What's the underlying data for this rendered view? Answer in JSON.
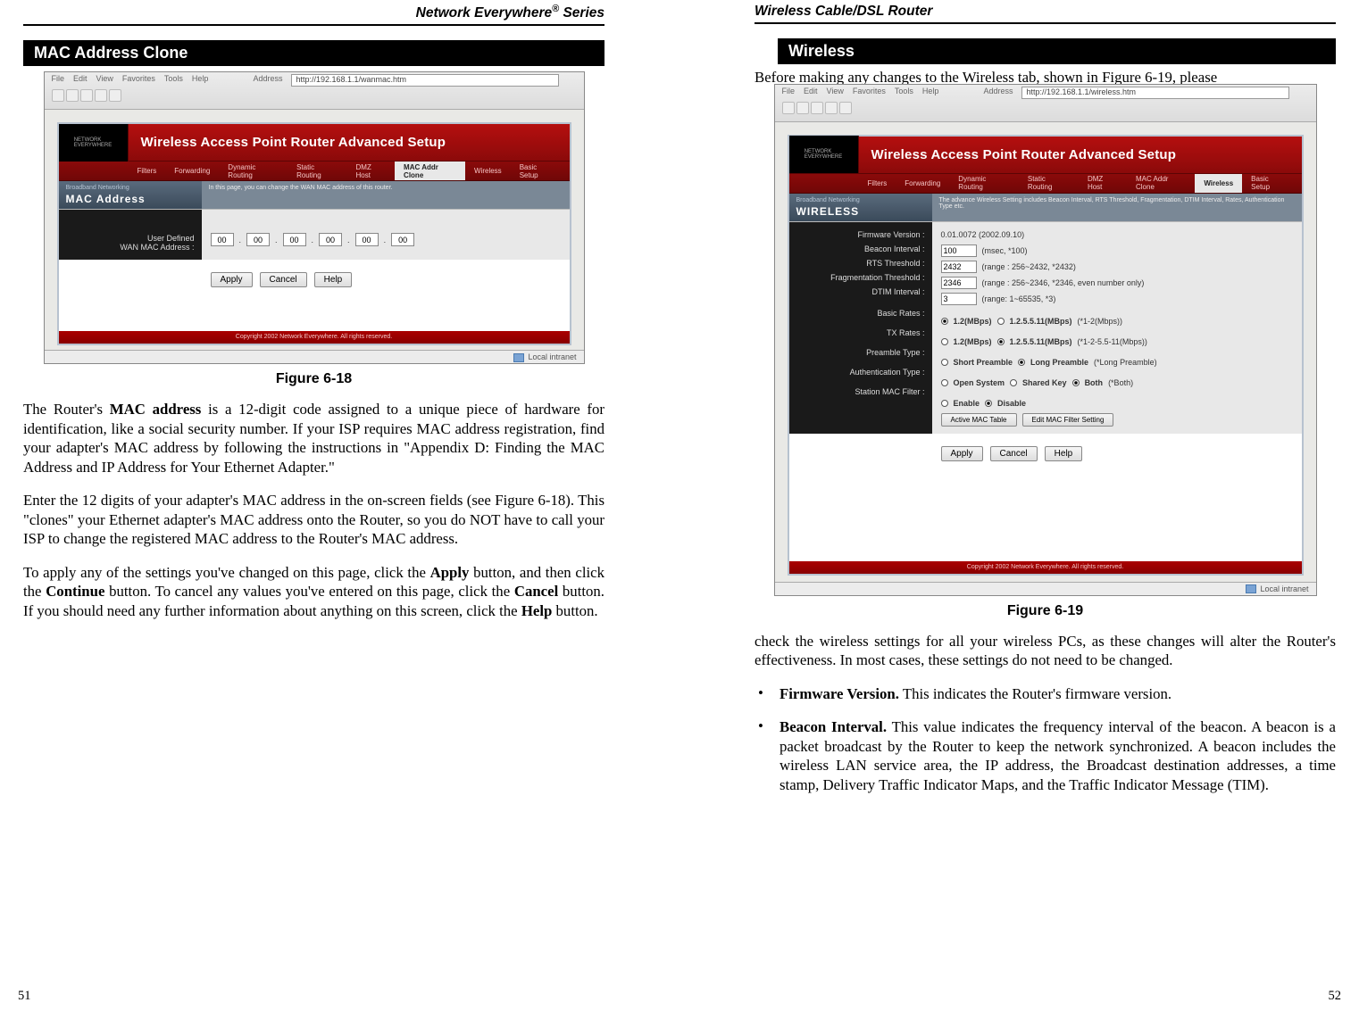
{
  "left": {
    "series_header": "Network Everywhere® Series",
    "section_title": "MAC Address Clone",
    "figure_caption": "Figure 6-18",
    "screenshot": {
      "menu": [
        "File",
        "Edit",
        "View",
        "Favorites",
        "Tools",
        "Help"
      ],
      "address_label": "Address",
      "url": "http://192.168.1.1/wanmac.htm",
      "router_title": "Wireless Access Point Router Advanced Setup",
      "tabs": [
        "Filters",
        "Forwarding",
        "Dynamic Routing",
        "Static Routing",
        "DMZ Host",
        "MAC Addr Clone",
        "Wireless"
      ],
      "basic_setup": "Basic Setup",
      "active_tab": "MAC Addr Clone",
      "sub_tiny": "Broadband Networking",
      "sub_big": "MAC Address",
      "sub_desc": "In this page, you can change the WAN MAC address of this router.",
      "field_label": "User Defined\nWAN MAC Address :",
      "mac": [
        "00",
        "00",
        "00",
        "00",
        "00",
        "00"
      ],
      "buttons": [
        "Apply",
        "Cancel",
        "Help"
      ],
      "copyright": "Copyright 2002 Network Everywhere. All rights reserved.",
      "status": "Local intranet"
    },
    "para1": "The Router's MAC address is a 12-digit code assigned to a unique piece of hardware for identification, like a social security number. If your ISP requires MAC address registration, find your adapter's MAC address by following the instructions in \"Appendix D: Finding the MAC Address and IP Address for Your Ethernet Adapter.\"",
    "para2": "Enter the 12 digits of your adapter's MAC address in the on-screen fields (see Figure 6-18). This \"clones\" your Ethernet adapter's MAC address onto the Router, so you do NOT have to call your ISP to change the registered MAC address to the Router's MAC address.",
    "para3": "To apply any of the settings you've changed on this page, click the Apply button, and then click the Continue button.  To cancel any values you've entered on this page, click the Cancel button. If you should need any further information about anything on this screen, click the Help button.",
    "page_number": "51"
  },
  "right": {
    "series_header": "Wireless Cable/DSL Router",
    "section_title": "Wireless",
    "overlap": "Before making any changes to the Wireless tab, shown in Figure 6-19, please",
    "figure_caption": "Figure 6-19",
    "screenshot": {
      "menu": [
        "File",
        "Edit",
        "View",
        "Favorites",
        "Tools",
        "Help"
      ],
      "address_label": "Address",
      "url": "http://192.168.1.1/wireless.htm",
      "router_title": "Wireless Access Point Router Advanced Setup",
      "tabs": [
        "Filters",
        "Forwarding",
        "Dynamic Routing",
        "Static Routing",
        "DMZ Host",
        "MAC Addr Clone",
        "Wireless"
      ],
      "basic_setup": "Basic Setup",
      "active_tab": "Wireless",
      "sub_tiny": "Broadband Networking",
      "sub_big": "WIRELESS",
      "sub_desc": "The advance Wireless Setting includes Beacon Interval, RTS Threshold, Fragmentation, DTIM Interval, Rates, Authentication Type etc.",
      "labels": [
        "Firmware Version :",
        "Beacon Interval :",
        "RTS Threshold :",
        "Fragmentation Threshold :",
        "DTIM Interval :",
        "Basic Rates :",
        "TX Rates :",
        "Preamble Type :",
        "Authentication Type :",
        "Station MAC Filter :"
      ],
      "firmware": "0.01.0072 (2002.09.10)",
      "beacon_val": "100",
      "beacon_hint": "(msec, *100)",
      "rts_val": "2432",
      "rts_hint": "(range : 256~2432, *2432)",
      "frag_val": "2346",
      "frag_hint": "(range : 256~2346, *2346, even number only)",
      "dtim_val": "3",
      "dtim_hint": "(range: 1~65535, *3)",
      "basic_opts": [
        "1.2(MBps)",
        "1.2.5.5.11(MBps)"
      ],
      "basic_def": "(*1-2(Mbps))",
      "tx_opts": [
        "1.2(MBps)",
        "1.2.5.5.11(MBps)"
      ],
      "tx_def": "(*1-2-5.5-11(Mbps))",
      "preamble_opts": [
        "Short Preamble",
        "Long Preamble"
      ],
      "preamble_def": "(*Long Preamble)",
      "auth_opts": [
        "Open System",
        "Shared Key",
        "Both"
      ],
      "auth_def": "(*Both)",
      "filter_opts": [
        "Enable",
        "Disable"
      ],
      "filter_btn1": "Active MAC Table",
      "filter_btn2": "Edit MAC Filter Setting",
      "buttons": [
        "Apply",
        "Cancel",
        "Help"
      ],
      "copyright": "Copyright 2002 Network Everywhere. All rights reserved.",
      "status": "Local intranet"
    },
    "para1": "check the wireless settings for all your wireless PCs, as these changes will alter the Router's effectiveness. In most cases, these settings do not need to be changed.",
    "bullet1_bold": "Firmware Version.",
    "bullet1_rest": "  This indicates the Router's firmware version.",
    "bullet2_bold": "Beacon Interval.",
    "bullet2_rest": "  This value indicates the frequency interval of the beacon. A beacon is a packet broadcast by the Router to keep the network synchronized. A beacon includes the wireless LAN service area, the IP address, the Broadcast destination addresses, a time stamp, Delivery Traffic Indicator Maps, and the Traffic Indicator Message (TIM).",
    "page_number": "52"
  }
}
